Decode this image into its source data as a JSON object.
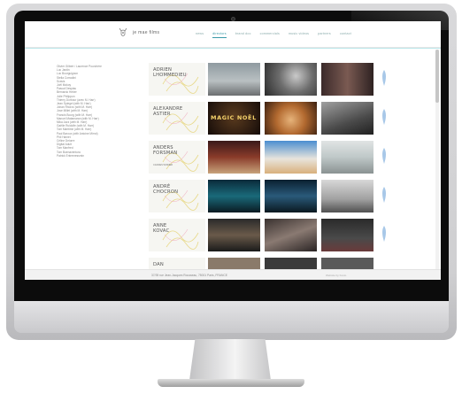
{
  "site": {
    "logo_text": "je mae films"
  },
  "nav": {
    "items": [
      {
        "label": "news",
        "active": false
      },
      {
        "label": "directors",
        "active": true
      },
      {
        "label": "brand doc",
        "active": false
      },
      {
        "label": "commercials",
        "active": false
      },
      {
        "label": "music videos",
        "active": false
      },
      {
        "label": "partners",
        "active": false
      },
      {
        "label": "contact",
        "active": false
      }
    ]
  },
  "sidebar": {
    "items": [
      "Olivier Gilbert / Laurence Pourchère",
      "Luc Jardin",
      "Luc Bourguignon",
      "Stella Corradini",
      "Scavis",
      "Joël Mokoy",
      "Pascal Despiau",
      "Bernardo Heber",
      "Julie Philippon",
      "Thierry Dorbour (avec M. Harr)",
      "Jean Spiegel (with M. Harr)",
      "Johan Rhorzo (with M. Harr)",
      "Jose Millet (with M. Harr)",
      "Francis Bourg (with M. Harr)",
      "Manuel Matamaran (with M. Harr)",
      "Mika Jazz (with M. Harr)",
      "Gaëlle Ruidolfe (with M. Harr)",
      "Tom Maritime (with M. Harr)",
      "Paul Baroux (with Antoine Mirrot)",
      "Phil Hamet",
      "Céline Delorre",
      "Digital Adult",
      "Tom Manfred",
      "Tom Buenaventura",
      "Patrick Entremessmin"
    ]
  },
  "directors": [
    {
      "name_lines": [
        "Adrien",
        "Lhommedieu"
      ],
      "subtitle": ""
    },
    {
      "name_lines": [
        "Alexandre",
        "Astier"
      ],
      "subtitle": ""
    },
    {
      "name_lines": [
        "Anders",
        "Forsman"
      ],
      "subtitle": "CANNES WINNER"
    },
    {
      "name_lines": [
        "André",
        "Chocron"
      ],
      "subtitle": ""
    },
    {
      "name_lines": [
        "Anne",
        "Kovac"
      ],
      "subtitle": ""
    },
    {
      "name_lines": [
        "Dan"
      ],
      "subtitle": ""
    }
  ],
  "thumb_caption": "MAGIC NOËL",
  "footer": {
    "address": "37/39 rue Jean-Jacques Rousseau, 75001 Paris, FRANCE",
    "right": "Website by Konio"
  },
  "colors": {
    "accent": "#3a9aa8",
    "feather": "#a8c8e8",
    "footer_bg": "#f2f2f2"
  },
  "icons": {
    "logo": "reindeer-logo-icon",
    "row_feather": "feather-icon"
  }
}
